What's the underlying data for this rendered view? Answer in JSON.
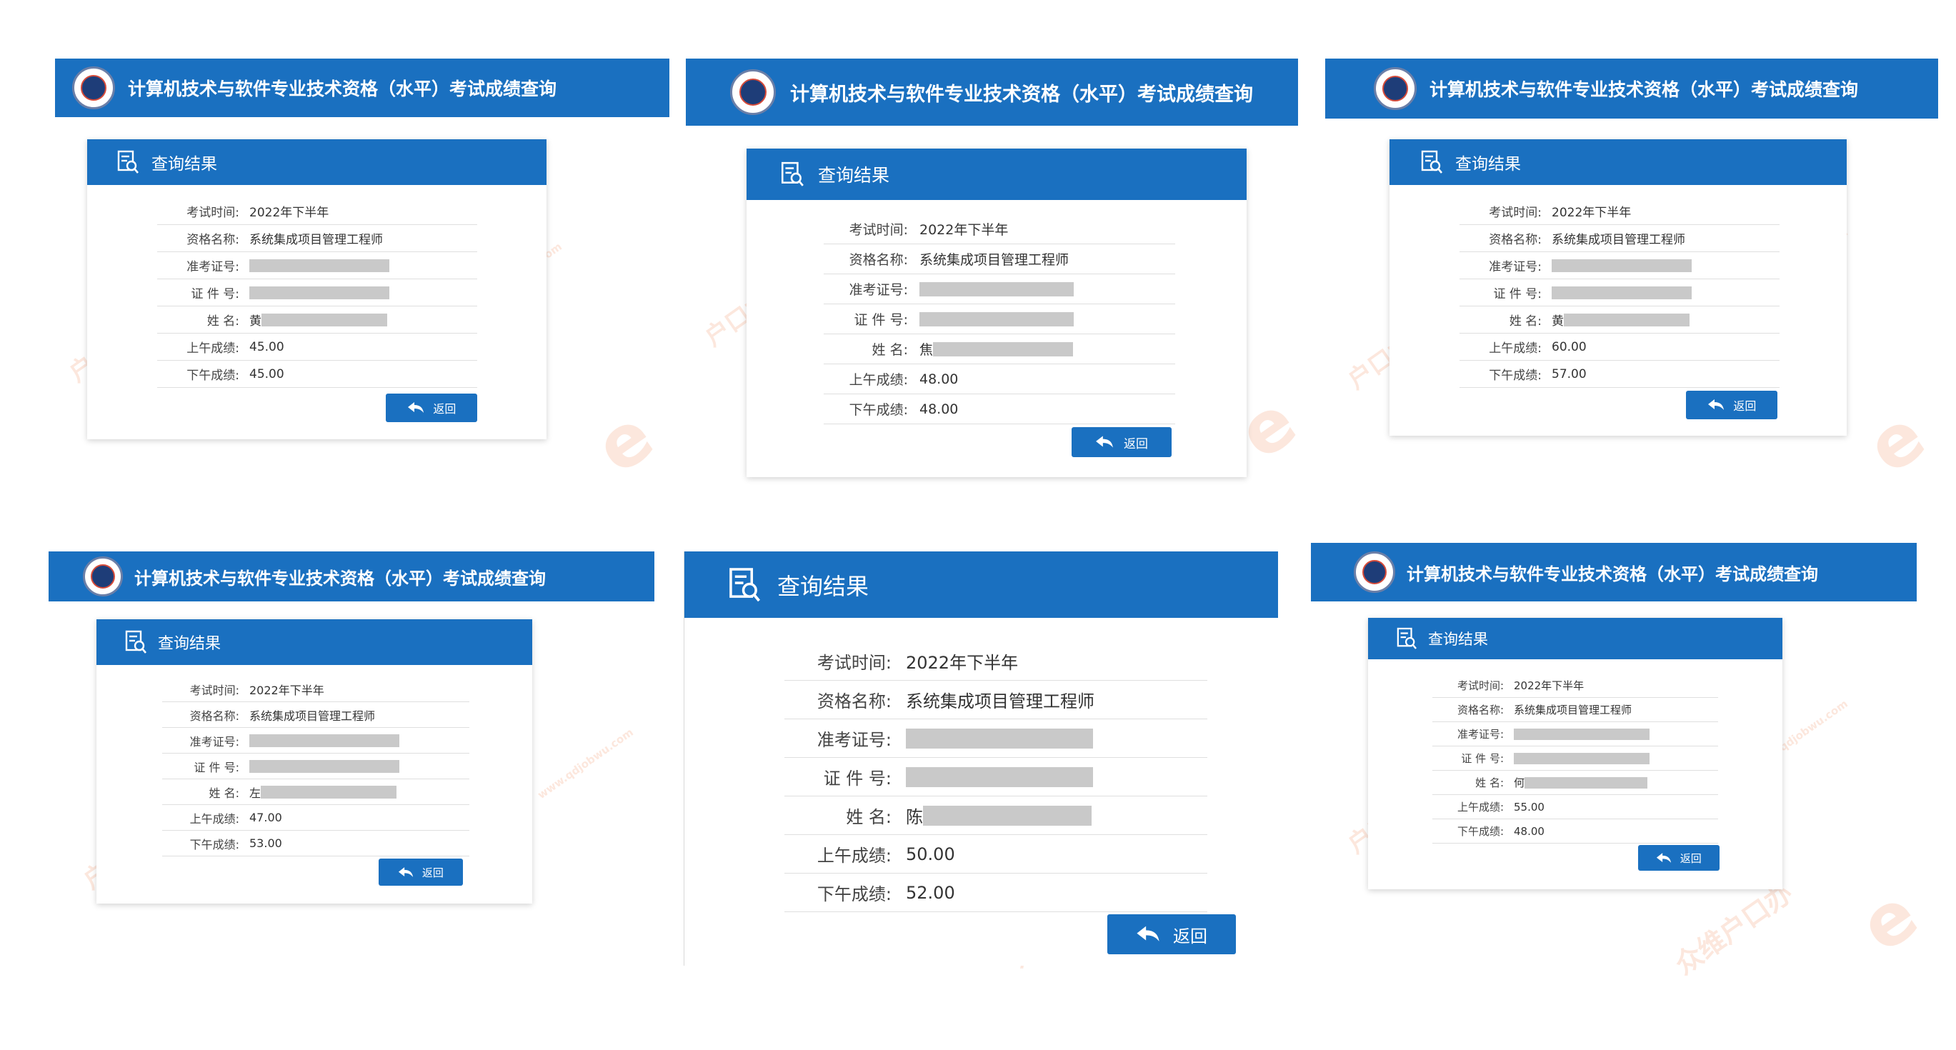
{
  "banner_title": "计算机技术与软件专业技术资格（水平）考试成绩查询",
  "panel_title": "查询结果",
  "back_label": "返回",
  "labels": {
    "exam_time": "考试时间:",
    "qualification": "资格名称:",
    "ticket": "准考证号:",
    "id": "证 件 号:",
    "name": "姓      名:",
    "am": "上午成绩:",
    "pm": "下午成绩:"
  },
  "watermarks": {
    "brand": "众维户口办",
    "domain": "www.qdjobwu.com",
    "logo": "e",
    "hukou": "户口办"
  },
  "colors": {
    "accent": "#1a70c0",
    "mask": "#c9c9c9",
    "watermark": "#f4a884"
  },
  "results": [
    {
      "exam_time": "2022年下半年",
      "qualification": "系统集成项目管理工程师",
      "name_prefix": "黄",
      "am": "45.00",
      "pm": "45.00"
    },
    {
      "exam_time": "2022年下半年",
      "qualification": "系统集成项目管理工程师",
      "name_prefix": "焦",
      "am": "48.00",
      "pm": "48.00"
    },
    {
      "exam_time": "2022年下半年",
      "qualification": "系统集成项目管理工程师",
      "name_prefix": "黄",
      "am": "60.00",
      "pm": "57.00"
    },
    {
      "exam_time": "2022年下半年",
      "qualification": "系统集成项目管理工程师",
      "name_prefix": "左",
      "am": "47.00",
      "pm": "53.00"
    },
    {
      "exam_time": "2022年下半年",
      "qualification": "系统集成项目管理工程师",
      "name_prefix": "陈",
      "am": "50.00",
      "pm": "52.00"
    },
    {
      "exam_time": "2022年下半年",
      "qualification": "系统集成项目管理工程师",
      "name_prefix": "何",
      "am": "55.00",
      "pm": "48.00"
    }
  ]
}
